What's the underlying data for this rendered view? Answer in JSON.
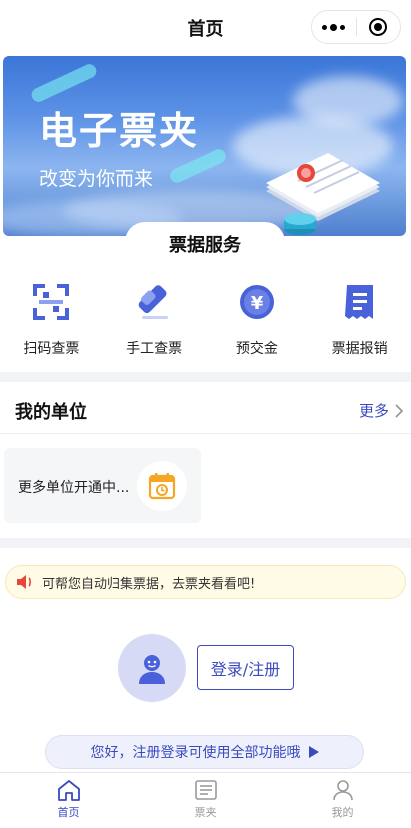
{
  "header": {
    "title": "首页"
  },
  "banner": {
    "title": "电子票夹",
    "subtitle": "改变为你而来"
  },
  "services_section": {
    "title": "票据服务"
  },
  "services": [
    {
      "label": "扫码查票",
      "icon": "scan-icon"
    },
    {
      "label": "手工查票",
      "icon": "pencil-icon"
    },
    {
      "label": "预交金",
      "icon": "yen-icon"
    },
    {
      "label": "票据报销",
      "icon": "receipt-icon"
    }
  ],
  "my_unit": {
    "title": "我的单位",
    "more_label": "更多",
    "card_text": "更多单位开通中..."
  },
  "notice": {
    "text": "可帮您自动归集票据，去票夹看看吧!"
  },
  "login": {
    "button_label": "登录/注册"
  },
  "hint": {
    "text": "您好，注册登录可使用全部功能哦"
  },
  "tabbar": [
    {
      "label": "首页",
      "active": true
    },
    {
      "label": "票夹",
      "active": false
    },
    {
      "label": "我的",
      "active": false
    }
  ],
  "colors": {
    "accent": "#3b4bbf",
    "icon_blue": "#4a62d9",
    "clock_orange": "#f5a623",
    "notice_red": "#e8453c"
  }
}
